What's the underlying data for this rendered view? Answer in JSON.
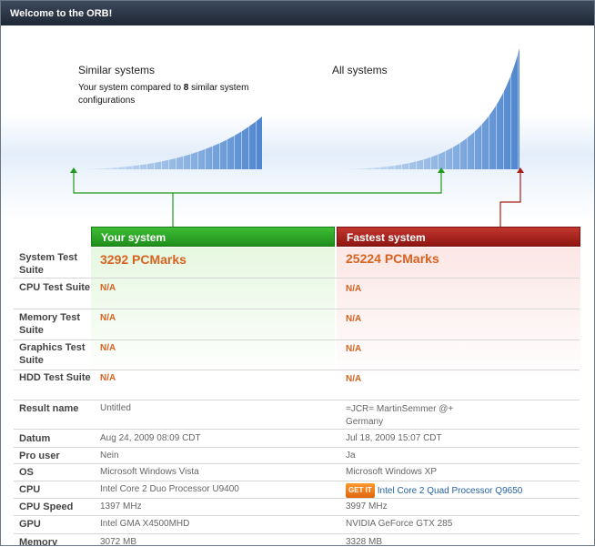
{
  "window": {
    "title": "Welcome to the ORB!"
  },
  "hero": {
    "similar_title": "Similar systems",
    "similar_desc_prefix": "Your system compared to ",
    "similar_count": "8",
    "similar_desc_suffix": " similar system configurations",
    "all_title": "All systems"
  },
  "columns": {
    "yours": "Your system",
    "fastest": "Fastest system"
  },
  "colors": {
    "green": "#2aa625",
    "red": "#a8201a",
    "orange": "#d9621f"
  },
  "rows": [
    {
      "label": "System Test Suite",
      "yours": "3292 PCMarks",
      "fastest": "25224 PCMarks"
    },
    {
      "label": "CPU Test Suite",
      "yours": "N/A",
      "fastest": "N/A"
    },
    {
      "label": "Memory Test Suite",
      "yours": "N/A",
      "fastest": "N/A"
    },
    {
      "label": "Graphics Test Suite",
      "yours": "N/A",
      "fastest": "N/A"
    },
    {
      "label": "HDD Test Suite",
      "yours": "N/A",
      "fastest": "N/A"
    },
    {
      "label": "Result name",
      "yours": "Untitled",
      "fastest": "=JCR= MartinSemmer @+ Germany"
    },
    {
      "label": "Datum",
      "yours": "Aug 24, 2009 08:09 CDT",
      "fastest": "Jul 18, 2009 15:07 CDT"
    },
    {
      "label": "Pro user",
      "yours": "Nein",
      "fastest": "Ja"
    },
    {
      "label": "OS",
      "yours": "Microsoft Windows Vista",
      "fastest": "Microsoft Windows XP"
    },
    {
      "label": "CPU",
      "yours": "Intel Core 2 Duo Processor U9400",
      "fastest": "Intel Core 2 Quad Processor Q9650",
      "fastest_badge": "GET IT"
    },
    {
      "label": "CPU Speed",
      "yours": "1397 MHz",
      "fastest": "3997 MHz"
    },
    {
      "label": "GPU",
      "yours": "Intel GMA X4500MHD",
      "fastest": "NVIDIA GeForce GTX 285"
    },
    {
      "label": "Memory",
      "yours": "3072 MB",
      "fastest": "3328 MB"
    }
  ]
}
